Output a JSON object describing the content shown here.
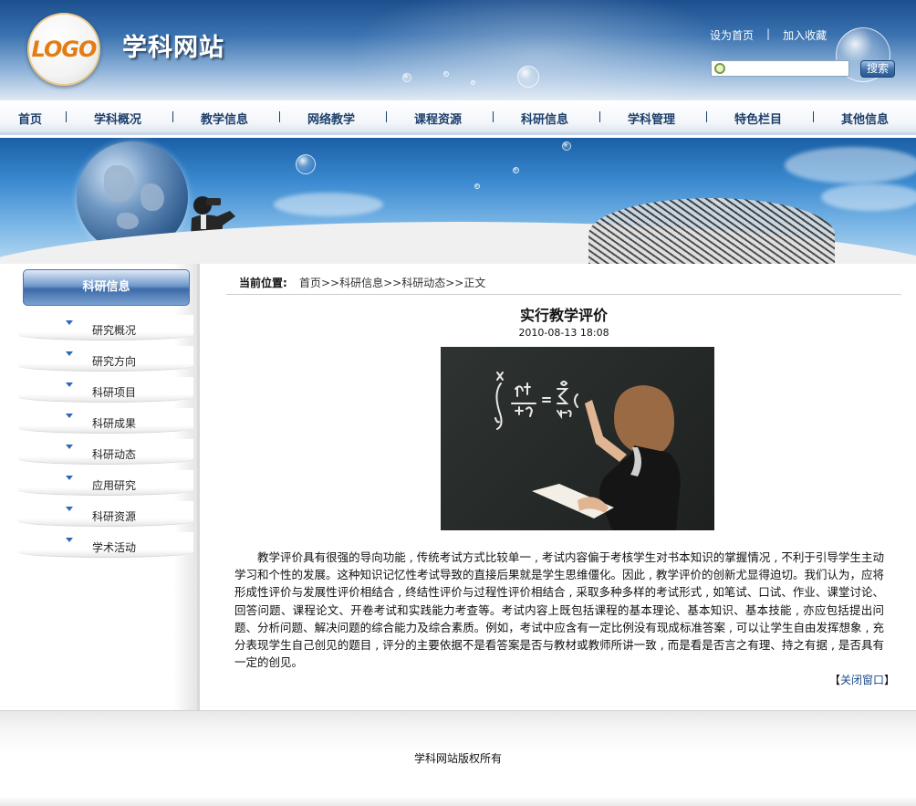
{
  "header": {
    "logo_text": "LOGO",
    "site_title": "学科网站",
    "set_homepage": "设为首页",
    "separator": "|",
    "add_favorite": "加入收藏",
    "search_placeholder": "",
    "search_button": "搜索"
  },
  "nav": {
    "items": [
      {
        "label": "首页"
      },
      {
        "label": "学科概况"
      },
      {
        "label": "教学信息"
      },
      {
        "label": "网络教学"
      },
      {
        "label": "课程资源"
      },
      {
        "label": "科研信息"
      },
      {
        "label": "学科管理"
      },
      {
        "label": "特色栏目"
      },
      {
        "label": "其他信息"
      }
    ]
  },
  "sidebar": {
    "title": "科研信息",
    "items": [
      {
        "label": "研究概况"
      },
      {
        "label": "研究方向"
      },
      {
        "label": "科研项目"
      },
      {
        "label": "科研成果"
      },
      {
        "label": "科研动态"
      },
      {
        "label": "应用研究"
      },
      {
        "label": "科研资源"
      },
      {
        "label": "学术活动"
      }
    ]
  },
  "breadcrumb": {
    "label": "当前位置:",
    "path": "首页>>科研信息>>科研动态>>正文"
  },
  "article": {
    "title": "实行教学评价",
    "date": "2010-08-13 18:08",
    "body": "教学评价具有很强的导向功能 , 传统考试方式比较单一 , 考试内容偏于考核学生对书本知识的掌握情况 , 不利于引导学生主动学习和个性的发展。这种知识记忆性考试导致的直接后果就是学生思维僵化。因此 , 教学评价的创新尤显得迫切。我们认为，应将形成性评价与发展性评价相结合 , 终结性评价与过程性评价相结合 , 采取多种多样的考试形式 , 如笔试、口试、作业、课堂讨论、回答问题、课程论文、开卷考试和实践能力考查等。考试内容上既包括课程的基本理论、基本知识、基本技能 , 亦应包括提出问题、分析问题、解决问题的综合能力及综合素质。例如，考试中应含有一定比例没有现成标准答案 , 可以让学生自由发挥想象 , 充分表现学生自己创见的题目 , 评分的主要依据不是看答案是否与教材或教师所讲一致 , 而是看是否言之有理、持之有据 , 是否具有一定的创见。",
    "close_open": "【",
    "close_label": "关闭窗口",
    "close_end": "】"
  },
  "footer": {
    "copyright": "学科网站版权所有"
  },
  "colors": {
    "header_blue": "#1c4f8e",
    "nav_text": "#1d3f6c",
    "link_blue": "#1a4a8a"
  }
}
